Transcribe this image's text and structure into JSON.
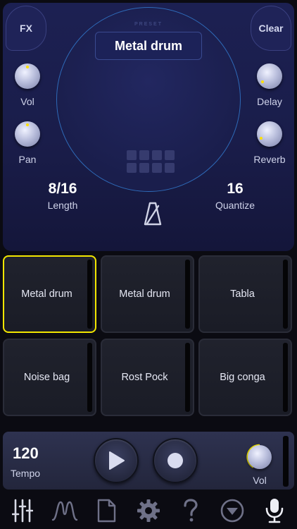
{
  "top": {
    "fx_label": "FX",
    "clear_label": "Clear",
    "preset_caption": "PRESET",
    "preset_name": "Metal drum",
    "knobs": {
      "vol": {
        "label": "Vol"
      },
      "pan": {
        "label": "Pan"
      },
      "delay": {
        "label": "Delay"
      },
      "reverb": {
        "label": "Reverb"
      }
    },
    "length": {
      "value": "8/16",
      "label": "Length"
    },
    "quantize": {
      "value": "16",
      "label": "Quantize"
    }
  },
  "pads": [
    {
      "label": "Metal drum",
      "selected": true
    },
    {
      "label": "Metal drum",
      "selected": false
    },
    {
      "label": "Tabla",
      "selected": false
    },
    {
      "label": "Noise bag",
      "selected": false
    },
    {
      "label": "Rost Pock",
      "selected": false
    },
    {
      "label": "Big conga",
      "selected": false
    }
  ],
  "transport": {
    "tempo_value": "120",
    "tempo_label": "Tempo",
    "vol_label": "Vol"
  },
  "toolbar": {
    "items": [
      "mixer-sliders-icon",
      "envelope-wave-icon",
      "file-icon",
      "settings-gear-icon",
      "help-question-icon",
      "dropdown-circle-icon",
      "microphone-icon"
    ]
  },
  "colors": {
    "selected_pad": "#f2e600",
    "panel": "#1c2052",
    "circle_stroke": "#2e6ab8",
    "knob_indicator": "#ffe100"
  }
}
